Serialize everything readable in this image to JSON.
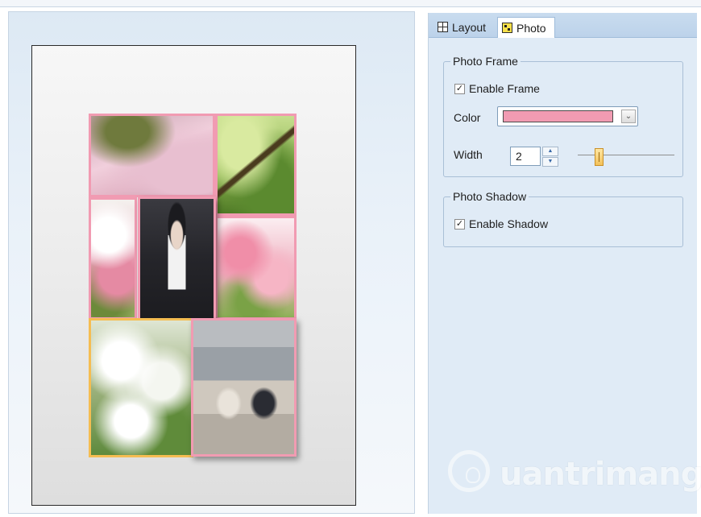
{
  "tabs": [
    {
      "label": "Layout",
      "icon": "layout-grid-icon",
      "selected": false
    },
    {
      "label": "Photo",
      "icon": "photo-icon",
      "selected": true
    }
  ],
  "photo_frame": {
    "legend": "Photo Frame",
    "enable_label": "Enable Frame",
    "enabled": true,
    "color_label": "Color",
    "color_value": "#f19bb2",
    "width_label": "Width",
    "width_value": "2"
  },
  "photo_shadow": {
    "legend": "Photo Shadow",
    "enable_label": "Enable Shadow",
    "enabled": true
  },
  "watermark": "uantrimang",
  "colors": {
    "frame_pink": "#f19bb2",
    "selected_frame": "#f5bd52",
    "panel_bg": "#e0ebf6"
  },
  "collage": {
    "photos": [
      "pink-blossom-path-photo",
      "green-tree-branch-photo",
      "pink-flowers-left-photo",
      "portrait-man-photo",
      "pink-cherry-blossom-photo",
      "white-blossom-photo",
      "two-men-sitting-photo"
    ],
    "selected_photo": "white-blossom-photo"
  }
}
